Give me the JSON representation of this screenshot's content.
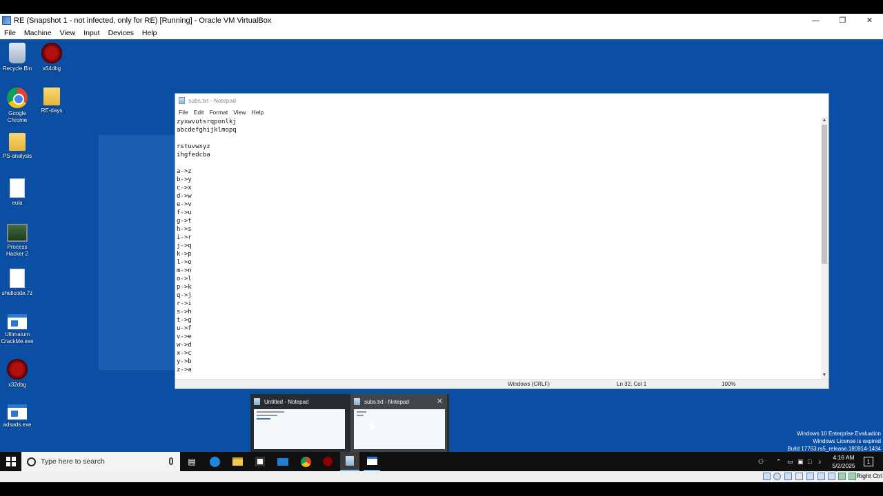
{
  "host": {
    "title": "RE (Snapshot 1 - not infected, only for RE) [Running] - Oracle VM VirtualBox",
    "menu": [
      "File",
      "Machine",
      "View",
      "Input",
      "Devices",
      "Help"
    ],
    "window_controls": [
      "minimize",
      "restore",
      "close"
    ],
    "status_right": "Right Ctrl"
  },
  "desktop": {
    "background": "#0a4fa3",
    "icons": [
      {
        "label": "Recycle Bin",
        "icon": "recycle-bin-icon"
      },
      {
        "label": "x64dbg",
        "icon": "bug-icon"
      },
      {
        "label": "Google Chrome",
        "icon": "chrome-icon"
      },
      {
        "label": "RE-days",
        "icon": "folder-icon"
      },
      {
        "label": "PS-analysis",
        "icon": "folder-icon"
      },
      {
        "label": "eula",
        "icon": "document-icon"
      },
      {
        "label": "Process Hacker 2",
        "icon": "process-hacker-icon"
      },
      {
        "label": "shellcode.7z",
        "icon": "document-icon"
      },
      {
        "label": "Ultimatum CrackMe.exe",
        "icon": "exe-icon"
      },
      {
        "label": "x32dbg",
        "icon": "bug-icon"
      },
      {
        "label": "adsads.exe",
        "icon": "exe-icon"
      }
    ]
  },
  "notepad": {
    "title": "subs.txt - Notepad",
    "menu": [
      "File",
      "Edit",
      "Format",
      "View",
      "Help"
    ],
    "text": "zyxwvutsrqponlkj\nabcdefghijklmopq\n\nrstuvwxyz\nihgfedcba\n\na->z\nb->y\nc->x\nd->w\ne->v\nf->u\ng->t\nh->s\ni->r\nj->q\nk->p\nl->o\nm->n\no->l\np->k\nq->j\nr->i\ns->h\nt->g\nu->f\nv->e\nw->d\nx->c\ny->b\nz->a",
    "status": {
      "line_ending": "Windows (CRLF)",
      "position": "Ln 32, Col 1",
      "zoom": "100%"
    }
  },
  "thumbnails": [
    {
      "title": "Untitled - Notepad"
    },
    {
      "title": "subs.txt - Notepad",
      "close": "✕"
    }
  ],
  "watermark": {
    "line1": "Windows 10 Enterprise Evaluation",
    "line2": "Windows License is expired",
    "line3": "Build 17763.rs5_release.180914-1434"
  },
  "taskbar": {
    "search_placeholder": "Type here to search",
    "apps": [
      "task-view-icon",
      "edge-icon",
      "file-explorer-icon",
      "store-icon",
      "mail-icon",
      "chrome-icon",
      "x64dbg-icon",
      "notepad-icon",
      "app-window-icon"
    ],
    "time": "4:16 AM",
    "date": "5/2/2025",
    "notification_count": "1"
  }
}
